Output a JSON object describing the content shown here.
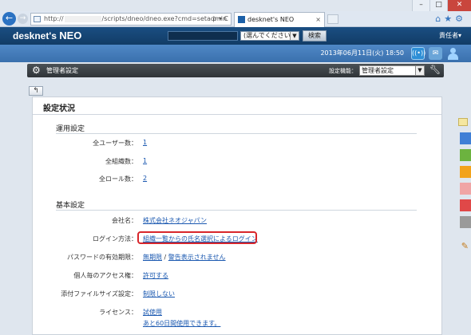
{
  "window": {
    "controls": [
      "–",
      "□",
      "✕"
    ]
  },
  "browser": {
    "back_icon": "back-arrow-icon",
    "url_prefix": "http://",
    "url_path": "/scripts/dneo/dneo.exe?cmd=setadmin",
    "addr_tools": "ρ ▾ C",
    "tab_title": "desknet's NEO",
    "tab_close": "×",
    "toolbar_icons": "⌂★⚙"
  },
  "app": {
    "logo_text": "desknet's",
    "logo_suffix": "NEO",
    "search_scope": "(選んでください)",
    "search_button": "検索",
    "user_menu": "責任者▾",
    "datetime": "2013年06月11日(火) 18:50"
  },
  "admin_bar": {
    "title": "管理者設定",
    "function_label": "設定機能：",
    "function_select": "管理者設定"
  },
  "panel": {
    "title": "設定状況",
    "sections": [
      {
        "heading": "運用設定",
        "rows": [
          {
            "label": "全ユーザー数：",
            "value": "1"
          },
          {
            "label": "全組織数：",
            "value": "1"
          },
          {
            "label": "全ロール数：",
            "value": "2"
          }
        ]
      },
      {
        "heading": "基本設定",
        "rows": [
          {
            "label": "会社名：",
            "value": "株式会社ネオジャパン"
          },
          {
            "label": "ログイン方法：",
            "value": "組織一覧からの氏名選択によるログイン"
          },
          {
            "label": "パスワードの有効期限：",
            "value": "無期限",
            "sep": "/",
            "value2": "警告表示されません"
          },
          {
            "label": "個人毎のアクセス権：",
            "value": "許可する"
          },
          {
            "label": "添付ファイルサイズ設定：",
            "value": "制限しない"
          },
          {
            "label": "ライセンス：",
            "value": "試使用",
            "value2": "あと60日間使用できます。"
          }
        ]
      }
    ]
  },
  "colors": {
    "header": "#1a4e82",
    "subheader": "#3a70ad",
    "link": "#1a58b0",
    "highlight": "#d8262b",
    "side_tabs": [
      "#3f7fd6",
      "#6cb33f",
      "#f2a31b",
      "#f0a5a5",
      "#e04848",
      "#9a9a9a"
    ]
  }
}
